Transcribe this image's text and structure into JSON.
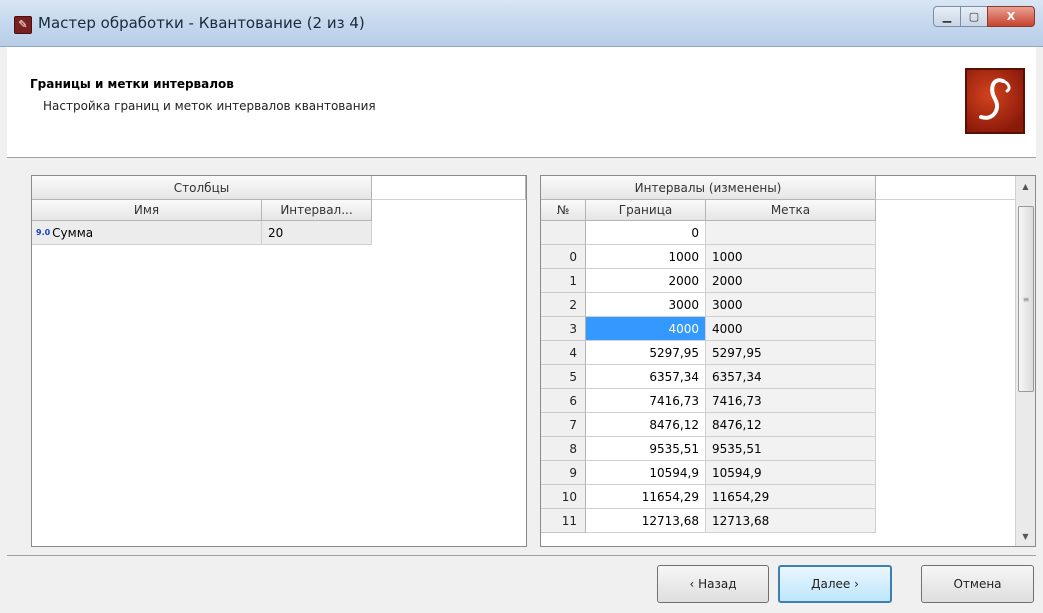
{
  "window": {
    "title": "Мастер обработки - Квантование (2 из 4)",
    "close_glyph": "X"
  },
  "header": {
    "title": "Границы и метки интервалов",
    "subtitle": "Настройка границ и меток интервалов квантования"
  },
  "columns_grid": {
    "group_header": "Столбцы",
    "col_name": "Имя",
    "col_interval": "Интервал...",
    "rows": [
      {
        "type_badge": "9.0",
        "name": "Сумма",
        "interval": "20"
      }
    ]
  },
  "intervals_grid": {
    "group_header": "Интервалы (изменены)",
    "col_num": "№",
    "col_bound": "Граница",
    "col_label": "Метка",
    "rows": [
      {
        "num": "",
        "bound": "0",
        "label": ""
      },
      {
        "num": "0",
        "bound": "1000",
        "label": "1000"
      },
      {
        "num": "1",
        "bound": "2000",
        "label": "2000"
      },
      {
        "num": "2",
        "bound": "3000",
        "label": "3000"
      },
      {
        "num": "3",
        "bound": "4000",
        "label": "4000",
        "selected": true
      },
      {
        "num": "4",
        "bound": "5297,95",
        "label": "5297,95"
      },
      {
        "num": "5",
        "bound": "6357,34",
        "label": "6357,34"
      },
      {
        "num": "6",
        "bound": "7416,73",
        "label": "7416,73"
      },
      {
        "num": "7",
        "bound": "8476,12",
        "label": "8476,12"
      },
      {
        "num": "8",
        "bound": "9535,51",
        "label": "9535,51"
      },
      {
        "num": "9",
        "bound": "10594,9",
        "label": "10594,9"
      },
      {
        "num": "10",
        "bound": "11654,29",
        "label": "11654,29"
      },
      {
        "num": "11",
        "bound": "12713,68",
        "label": "12713,68"
      }
    ]
  },
  "footer": {
    "back_label": "‹ Назад",
    "next_label": "Далее ›",
    "cancel_label": "Отмена"
  },
  "colors": {
    "selection": "#3399ff",
    "logo": "#b32a12"
  }
}
